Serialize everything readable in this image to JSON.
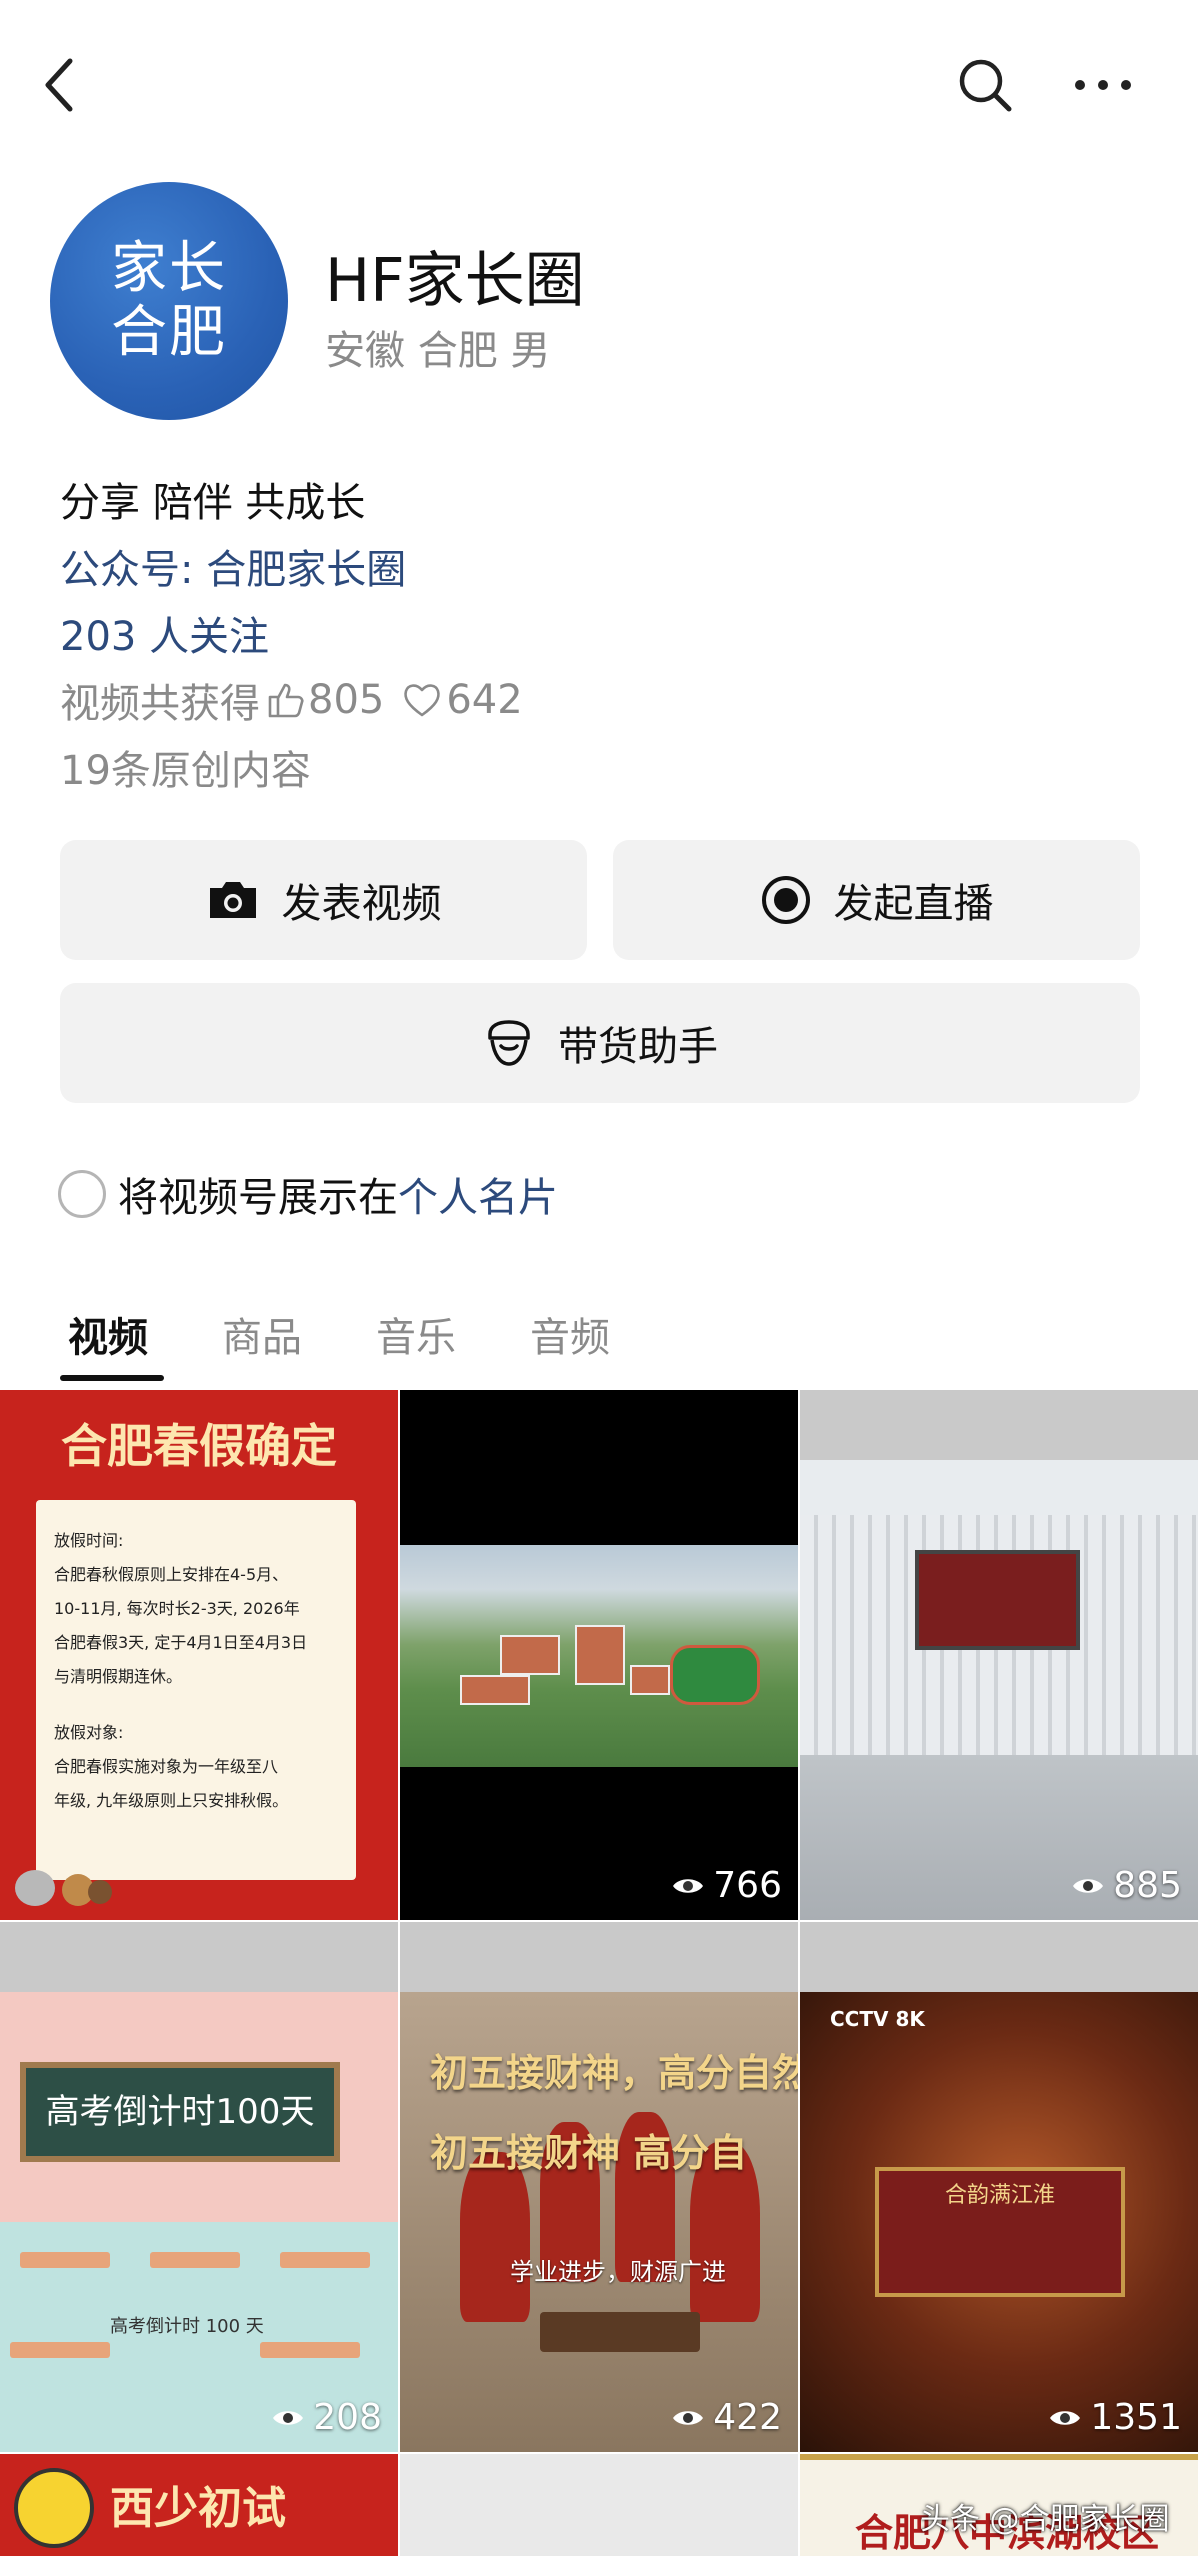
{
  "profile": {
    "avatar_line1": "家长",
    "avatar_line2": "合肥",
    "name": "HF家长圈",
    "meta": "安徽 合肥 男",
    "bio": "分享 陪伴 共成长",
    "official_account": "公众号: 合肥家长圈",
    "followers": "203 人关注",
    "likes_prefix": "视频共获得",
    "thumbs_count": "805",
    "hearts_count": "642",
    "original_content": "19条原创内容"
  },
  "actions": {
    "post_video": "发表视频",
    "start_live": "发起直播",
    "shop_assistant": "带货助手"
  },
  "card_toggle": {
    "text_prefix": "将视频号展示在",
    "link_text": "个人名片"
  },
  "tabs": [
    {
      "label": "视频"
    },
    {
      "label": "商品"
    },
    {
      "label": "音乐"
    },
    {
      "label": "音频"
    }
  ],
  "videos": [
    {
      "title": "合肥春假确定",
      "lines": [
        "放假时间:",
        "合肥春秋假原则上安排在4-5月、",
        "10-11月, 每次时长2-3天, 2026年",
        "合肥春假3天, 定于4月1日至4月3日",
        "与清明假期连休。",
        "",
        "放假对象:",
        "合肥春假实施对象为一年级至八",
        "年级, 九年级原则上只安排秋假。"
      ]
    },
    {
      "views": "766"
    },
    {
      "views": "885"
    },
    {
      "board_text": "高考倒计时100天",
      "sub_text": "高考倒计时 100 天",
      "views": "208"
    },
    {
      "line1": "初五接财神，高分自然",
      "line2": "初五接财神  高分自",
      "sub_text": "学业进步，财源广进",
      "views": "422"
    },
    {
      "logo": "CCTV 8K",
      "board_text": "合韵满江淮",
      "views": "1351"
    },
    {
      "title": "西少初试"
    },
    {},
    {
      "title": "合肥八中滨湖校区"
    }
  ],
  "watermark": "头条 @合肥家长圈",
  "colors": {
    "link": "#2c4a7c",
    "muted": "#8a8a8a",
    "button_bg": "#f2f2f2",
    "avatar": "#2a62b6"
  }
}
